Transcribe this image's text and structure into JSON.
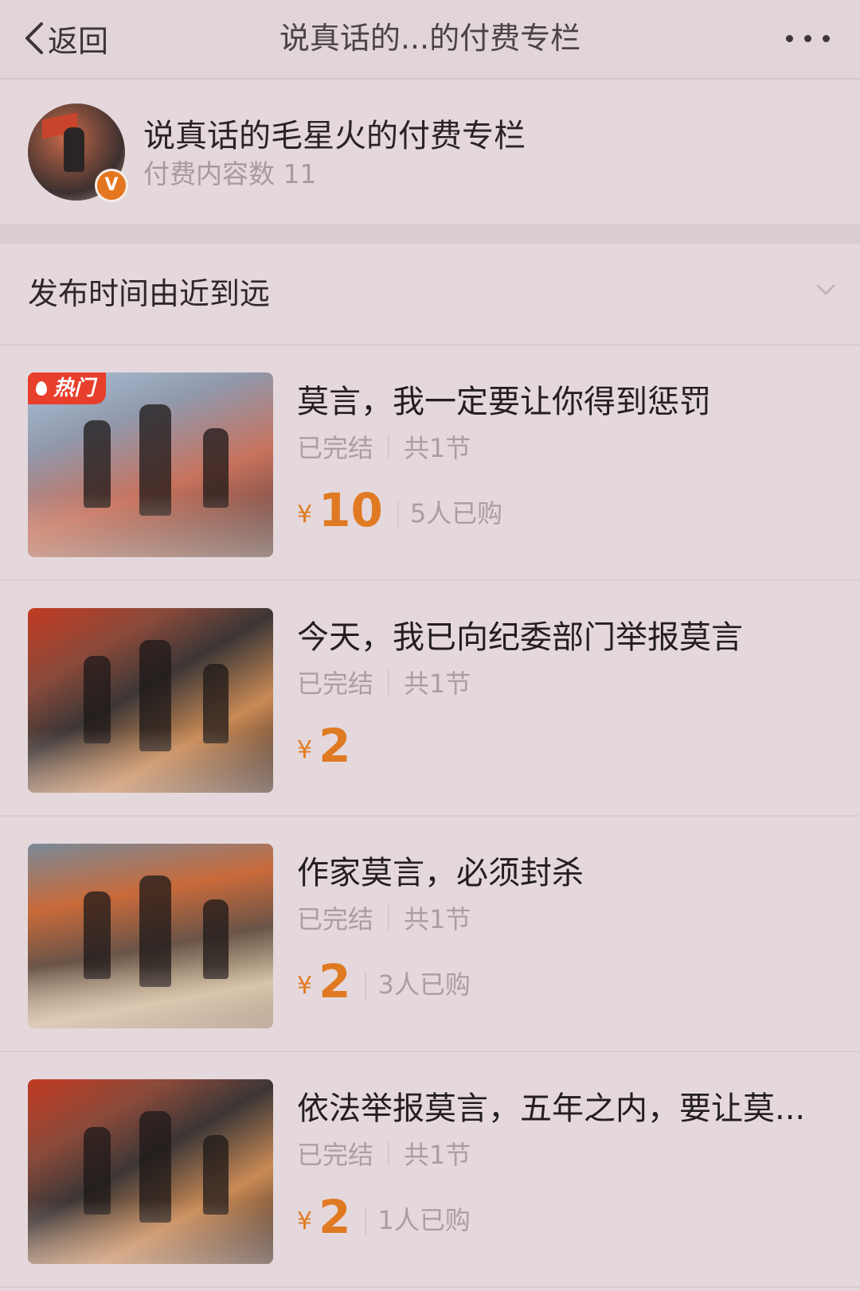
{
  "nav": {
    "back_label": "返回",
    "title": "说真话的...的付费专栏"
  },
  "profile": {
    "name": "说真话的毛星火的付费专栏",
    "count": "付费内容数 11",
    "badge": "V"
  },
  "sort": {
    "label": "发布时间由近到远"
  },
  "colors": {
    "price": "#e07a22",
    "hot_badge": "#e83e2c",
    "verified_badge": "#e4761f"
  },
  "items": [
    {
      "title": "莫言，我一定要让你得到惩罚",
      "status": "已完结",
      "sections": "共1节",
      "yen": "¥",
      "price": "10",
      "buyers": "5人已购",
      "hot": "热门"
    },
    {
      "title": "今天，我已向纪委部门举报莫言",
      "status": "已完结",
      "sections": "共1节",
      "yen": "¥",
      "price": "2"
    },
    {
      "title": "作家莫言，必须封杀",
      "status": "已完结",
      "sections": "共1节",
      "yen": "¥",
      "price": "2",
      "buyers": "3人已购"
    },
    {
      "title": "依法举报莫言，五年之内，要让莫...",
      "status": "已完结",
      "sections": "共1节",
      "yen": "¥",
      "price": "2",
      "buyers": "1人已购"
    }
  ]
}
